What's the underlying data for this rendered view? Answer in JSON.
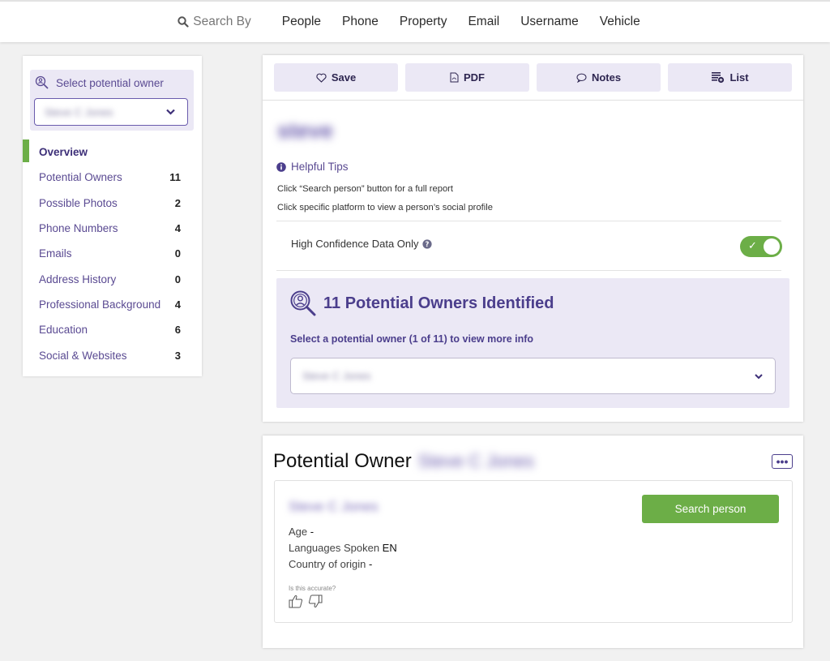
{
  "topnav": {
    "search_by": "Search By",
    "items": [
      "People",
      "Phone",
      "Property",
      "Email",
      "Username",
      "Vehicle"
    ]
  },
  "sidebar": {
    "select_label": "Select potential owner",
    "select_value": "Steve C Jones",
    "items": [
      {
        "label": "Overview",
        "count": ""
      },
      {
        "label": "Potential Owners",
        "count": "11"
      },
      {
        "label": "Possible Photos",
        "count": "2"
      },
      {
        "label": "Phone Numbers",
        "count": "4"
      },
      {
        "label": "Emails",
        "count": "0"
      },
      {
        "label": "Address History",
        "count": "0"
      },
      {
        "label": "Professional Background",
        "count": "4"
      },
      {
        "label": "Education",
        "count": "6"
      },
      {
        "label": "Social & Websites",
        "count": "3"
      }
    ]
  },
  "toolbar": {
    "save": "Save",
    "pdf": "PDF",
    "notes": "Notes",
    "list": "List"
  },
  "main": {
    "heading": "steve",
    "tips_title": "Helpful Tips",
    "tip1": "Click “Search person” button for a full report",
    "tip2": "Click specific platform to view a person’s social profile",
    "high_confidence_label": "High Confidence Data Only",
    "toggle_check": "✓",
    "owners_heading": "11 Potential Owners Identified",
    "owners_sub": "Select a potential owner (1 of 11) to view more info",
    "owners_select_value": "Steve C Jones"
  },
  "owner_card": {
    "title": "Potential Owner",
    "title_name": "Steve C Jones",
    "name": "Steve C Jones",
    "search_button": "Search person",
    "age_label": "Age",
    "age_value": "-",
    "languages_label": "Languages Spoken",
    "languages_value": "EN",
    "country_label": "Country of origin",
    "country_value": "-",
    "accurate_label": "Is this accurate?",
    "more_label": "•••"
  },
  "colors": {
    "accent_purple": "#5a4a92",
    "light_purple_bg": "#ebe8f5",
    "green": "#6cae47"
  }
}
